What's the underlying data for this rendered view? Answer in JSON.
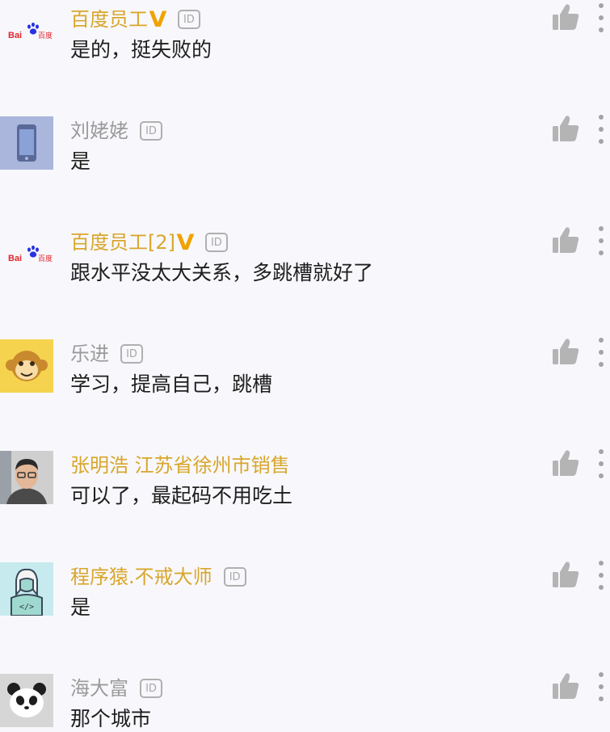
{
  "comments": [
    {
      "username": "百度员工",
      "verified": true,
      "id_badge": "ID",
      "content": "是的，挺失败的",
      "avatar": "baidu-logo",
      "avatar_logo_text": "Bai度百度"
    },
    {
      "username": "刘姥姥",
      "verified": false,
      "id_badge": "ID",
      "content": "是",
      "avatar": "phone-avatar"
    },
    {
      "username": "百度员工[2]",
      "verified": true,
      "id_badge": "ID",
      "content": "跟水平没太大关系，多跳槽就好了",
      "avatar": "baidu-logo",
      "avatar_logo_text": "Bai度百度"
    },
    {
      "username": "乐进",
      "verified": false,
      "id_badge": "ID",
      "content": "学习，提高自己，跳槽",
      "avatar": "monkey-avatar"
    },
    {
      "username": "张明浩 江苏省徐州市销售",
      "verified": false,
      "id_badge": "",
      "content": "可以了，最起码不用吃土",
      "avatar": "person-photo-avatar"
    },
    {
      "username": "程序猿.不戒大师",
      "verified": false,
      "id_badge": "ID",
      "content": "是",
      "avatar": "coder-avatar"
    },
    {
      "username": "海大富",
      "verified": false,
      "id_badge": "ID",
      "content": "那个城市",
      "avatar": "panda-avatar"
    }
  ],
  "colors": {
    "background": "#f8f8fc",
    "username_gold": "#d9a62c",
    "username_gray": "#9a9a9a",
    "verified_v": "#f0a300",
    "icon_gray": "#b4b4b4"
  }
}
